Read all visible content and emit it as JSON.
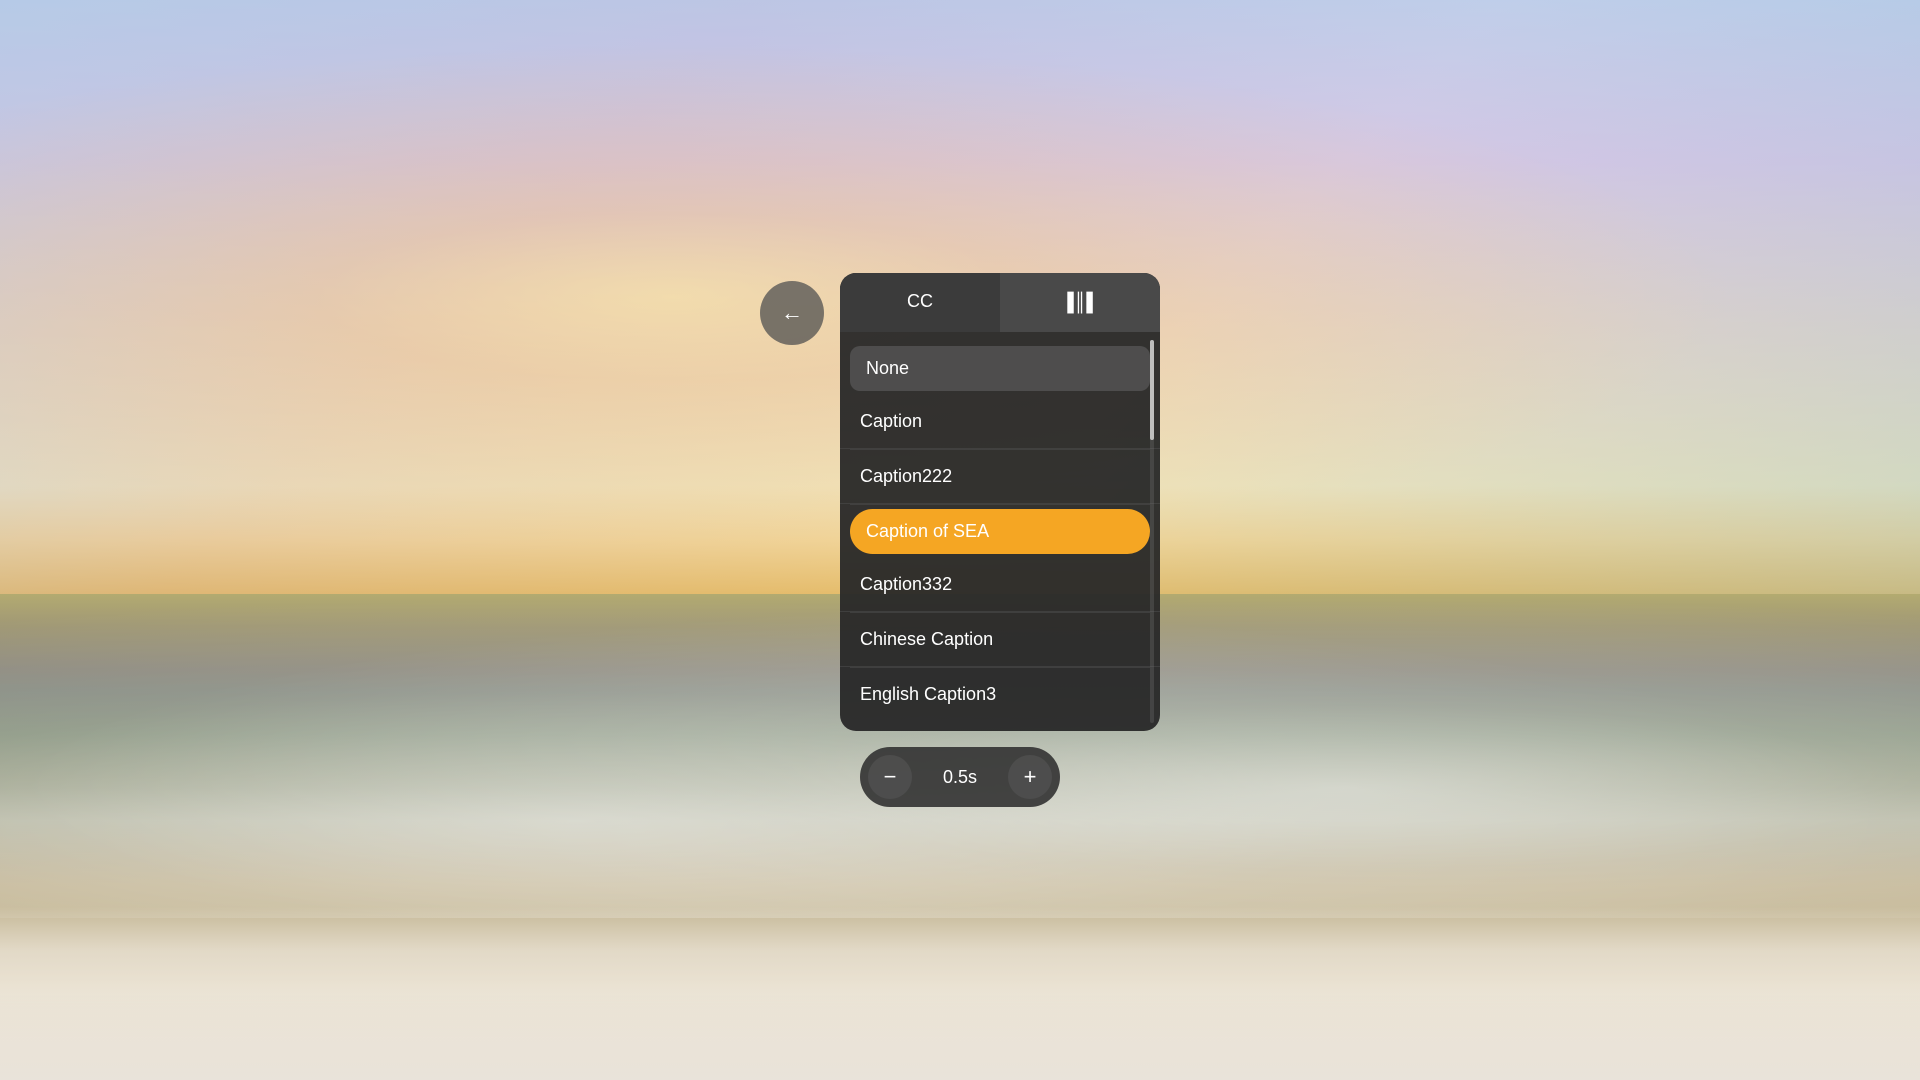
{
  "background": {
    "alt": "Beach sunset background"
  },
  "back_button": {
    "label": "←",
    "aria": "Back"
  },
  "panel": {
    "tabs": [
      {
        "id": "cc",
        "label": "CC",
        "active": true
      },
      {
        "id": "audio",
        "label": "▐║▌",
        "active": false
      }
    ],
    "list": {
      "items": [
        {
          "id": "none",
          "label": "None",
          "type": "none"
        },
        {
          "id": "caption",
          "label": "Caption",
          "type": "normal"
        },
        {
          "id": "caption222",
          "label": "Caption222",
          "type": "normal"
        },
        {
          "id": "caption-of-sea",
          "label": "Caption of SEA",
          "type": "selected"
        },
        {
          "id": "caption332",
          "label": "Caption332",
          "type": "normal"
        },
        {
          "id": "chinese-caption",
          "label": "Chinese Caption",
          "type": "normal"
        },
        {
          "id": "english-caption3",
          "label": "English Caption3",
          "type": "normal"
        }
      ]
    }
  },
  "timing": {
    "minus_label": "−",
    "plus_label": "+",
    "value": "0.5s"
  }
}
